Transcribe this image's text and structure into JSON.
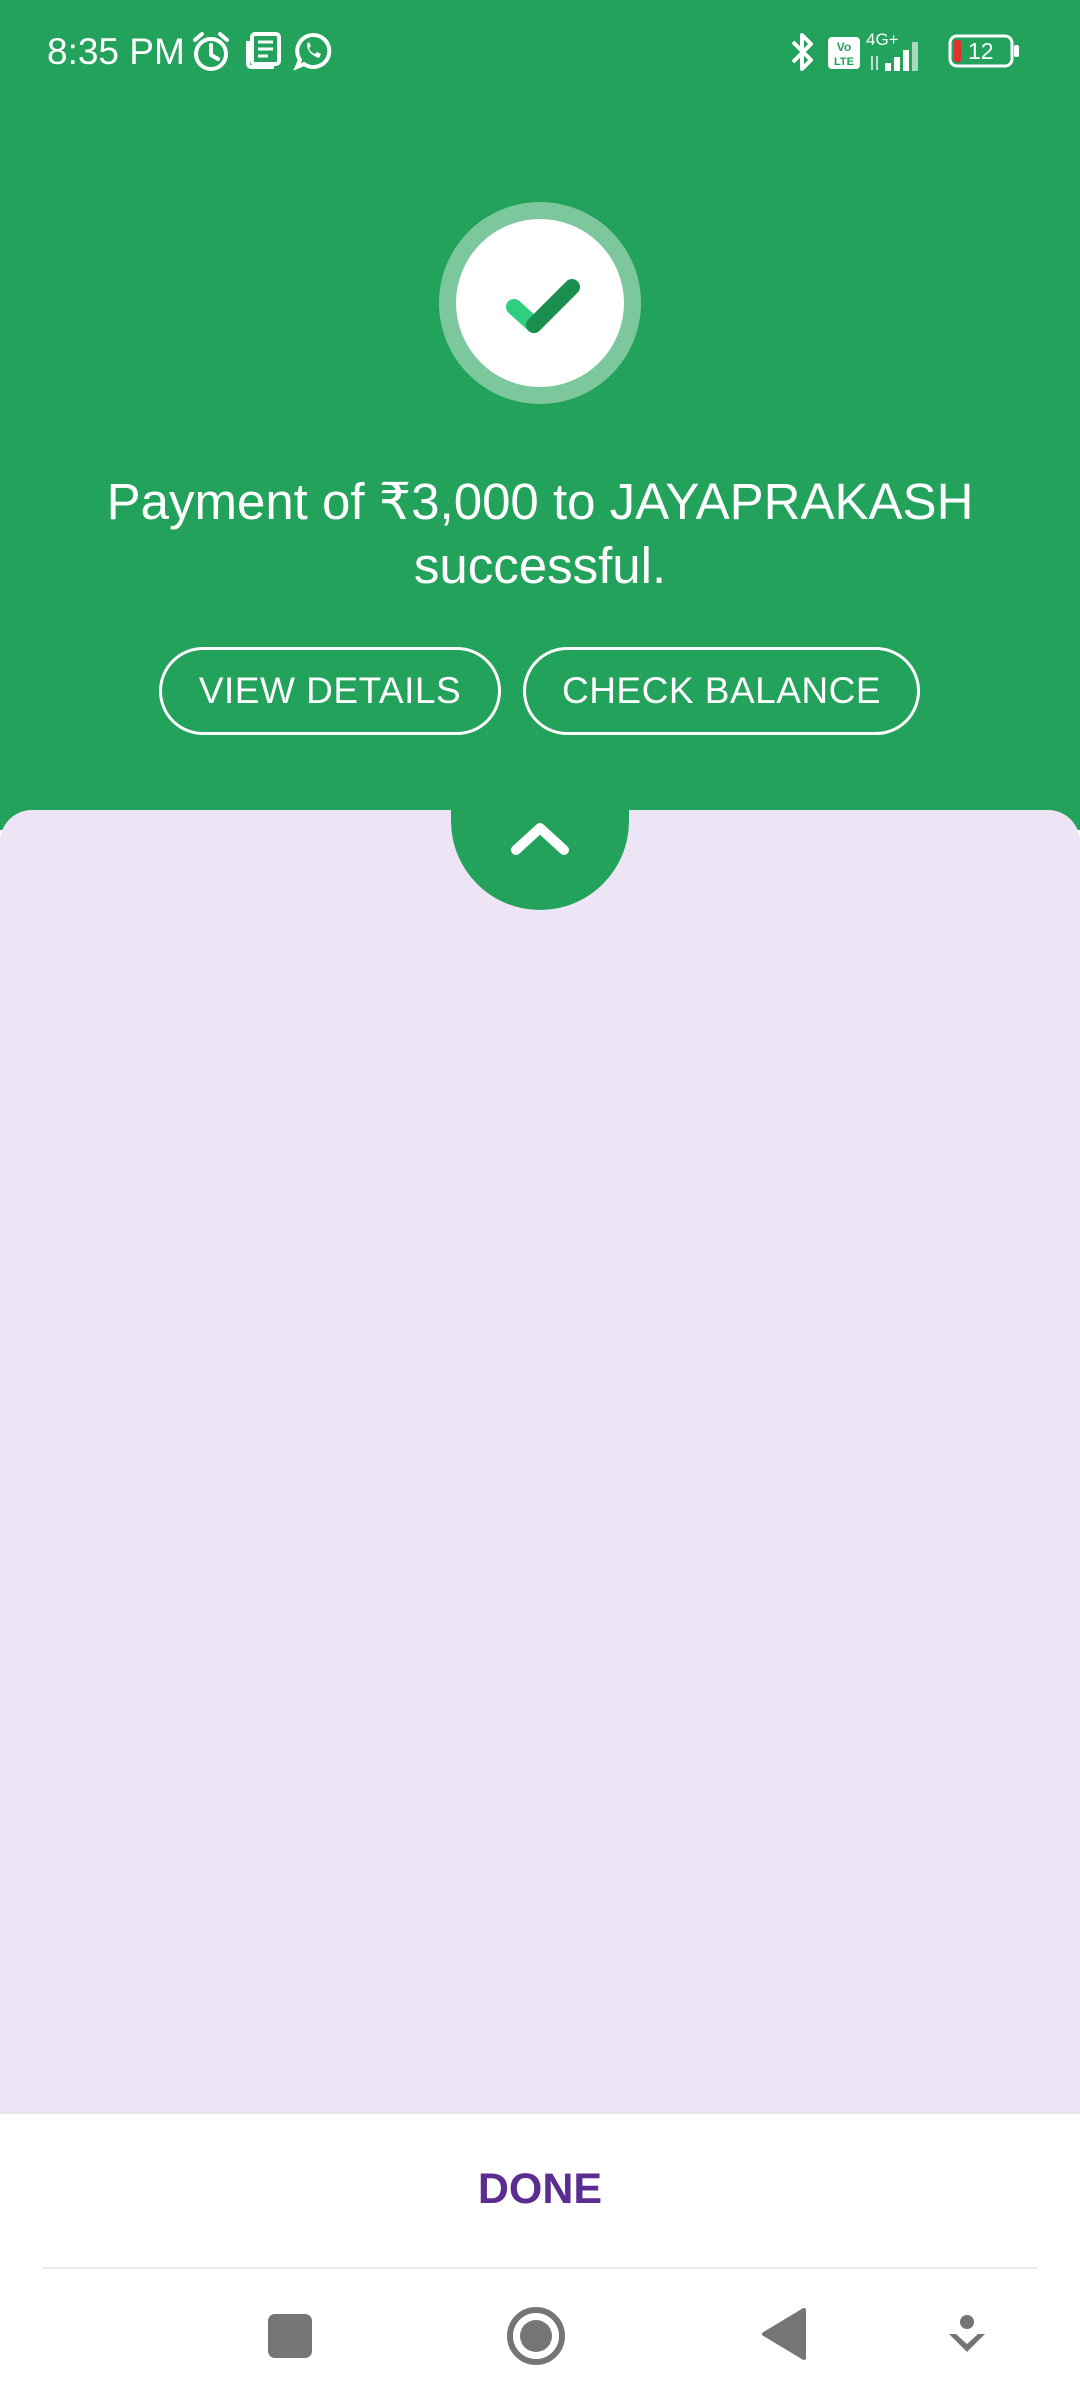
{
  "status_bar": {
    "time": "8:35 PM",
    "battery_level": "12",
    "network_type": "4G+",
    "icons_left": [
      "alarm-icon",
      "news-icon",
      "whatsapp-icon"
    ],
    "icons_right": [
      "bluetooth-icon",
      "volte-icon",
      "signal-icon",
      "battery-icon"
    ]
  },
  "success": {
    "icon": "check-circle-icon",
    "message": "Payment of ₹3,000 to JAYAPRAKASH successful."
  },
  "actions": {
    "view_details": "VIEW DETAILS",
    "check_balance": "CHECK BALANCE"
  },
  "sheet": {
    "handle_icon": "chevron-up-icon"
  },
  "footer": {
    "done_label": "DONE"
  },
  "nav_bar": {
    "buttons": [
      "square-recents-icon",
      "circle-home-icon",
      "triangle-back-icon",
      "down-arrow-icon"
    ]
  },
  "colors": {
    "green": "#23a25c",
    "sheet_lavender": "#ede5f6",
    "done_purple": "#5b2d90",
    "check_green": "#2fcf7f"
  }
}
